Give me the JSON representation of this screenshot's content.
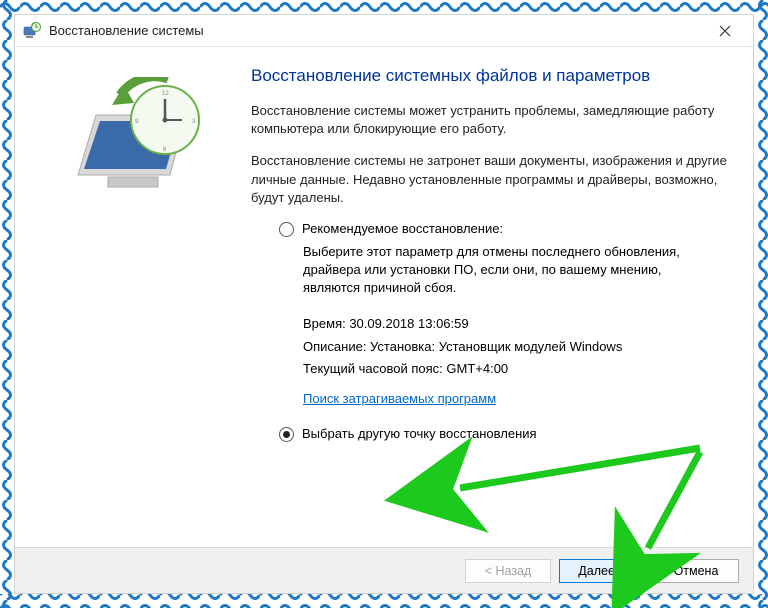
{
  "window": {
    "title": "Восстановление системы"
  },
  "main": {
    "heading": "Восстановление системных файлов и параметров",
    "para1": "Восстановление системы может устранить проблемы, замедляющие работу компьютера или блокирующие его работу.",
    "para2": "Восстановление системы не затронет ваши документы, изображения и другие личные данные. Недавно установленные программы и драйверы, возможно, будут удалены."
  },
  "options": {
    "recommended": {
      "label": "Рекомендуемое восстановление:",
      "description": "Выберите этот параметр для отмены последнего обновления, драйвера или установки ПО, если они, по вашему мнению, являются причиной сбоя.",
      "time_label": "Время: 30.09.2018 13:06:59",
      "desc_label": "Описание: Установка: Установщик модулей Windows",
      "tz_label": "Текущий часовой пояс: GMT+4:00",
      "link": "Поиск затрагиваемых программ"
    },
    "other": {
      "label": "Выбрать другую точку восстановления"
    }
  },
  "footer": {
    "back": "< Назад",
    "next": "Далее >",
    "cancel": "Отмена"
  }
}
